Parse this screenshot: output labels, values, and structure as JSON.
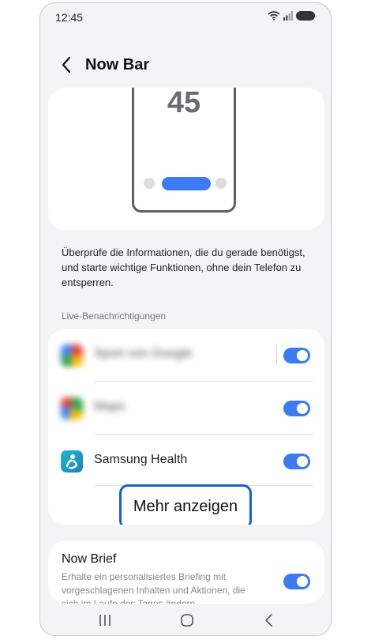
{
  "status_bar": {
    "time": "12:45"
  },
  "header": {
    "title": "Now Bar"
  },
  "preview": {
    "clock_digits": "45"
  },
  "description": "Überprüfe die Informationen, die du gerade benötigst, und starte wichtige Funktionen, ohne dein Telefon zu entsperren.",
  "live_notifications": {
    "section_label": "Live-Benachrichtigungen",
    "items": [
      {
        "label": "Sport von Google",
        "enabled": true,
        "blurred": true
      },
      {
        "label": "Maps",
        "enabled": true,
        "blurred": true
      },
      {
        "label": "Samsung Health",
        "enabled": true,
        "blurred": false
      }
    ],
    "more_button": "Mehr anzeigen"
  },
  "now_brief": {
    "title": "Now Brief",
    "description": "Erhalte ein personalisiertes Briefing mit vorgeschlagenen Inhalten und Aktionen, die sich im Laufe des Tages ändern.",
    "enabled": true
  },
  "colors": {
    "accent": "#3d7bf4",
    "highlight": "#1463c9",
    "background": "#f4f4f6"
  }
}
